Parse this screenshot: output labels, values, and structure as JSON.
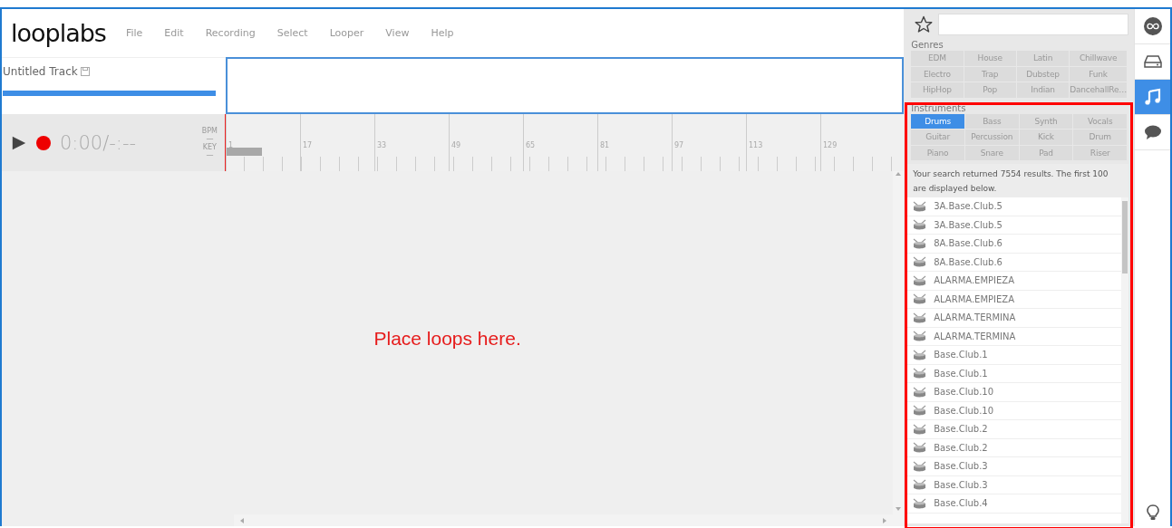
{
  "app": {
    "logo": "looplabs"
  },
  "menu": [
    {
      "label": "File"
    },
    {
      "label": "Edit"
    },
    {
      "label": "Recording"
    },
    {
      "label": "Select"
    },
    {
      "label": "Looper"
    },
    {
      "label": "View"
    },
    {
      "label": "Help"
    }
  ],
  "track": {
    "title": "Untitled Track",
    "level": 1
  },
  "transport": {
    "time": "0:00/-:--",
    "bpm_label": "BPM",
    "bpm_value": "—",
    "key_label": "KEY",
    "key_value": "—"
  },
  "ruler": [
    "1",
    "17",
    "33",
    "49",
    "65",
    "81",
    "97",
    "113",
    "129"
  ],
  "workspace": {
    "placeholder": "Place loops here."
  },
  "library": {
    "genres_label": "Genres",
    "genres": [
      {
        "label": "EDM",
        "selected": false
      },
      {
        "label": "House",
        "selected": false
      },
      {
        "label": "Latin",
        "selected": false
      },
      {
        "label": "Chillwave",
        "selected": false
      },
      {
        "label": "Electro",
        "selected": false
      },
      {
        "label": "Trap",
        "selected": false
      },
      {
        "label": "Dubstep",
        "selected": false
      },
      {
        "label": "Funk",
        "selected": false
      },
      {
        "label": "HipHop",
        "selected": false
      },
      {
        "label": "Pop",
        "selected": false
      },
      {
        "label": "Indian",
        "selected": false
      },
      {
        "label": "DancehallRe…",
        "selected": false
      }
    ],
    "instruments_label": "Instruments",
    "instruments": [
      {
        "label": "Drums",
        "selected": true
      },
      {
        "label": "Bass",
        "selected": false
      },
      {
        "label": "Synth",
        "selected": false
      },
      {
        "label": "Vocals",
        "selected": false
      },
      {
        "label": "Guitar",
        "selected": false
      },
      {
        "label": "Percussion",
        "selected": false
      },
      {
        "label": "Kick",
        "selected": false
      },
      {
        "label": "Drum",
        "selected": false
      },
      {
        "label": "Piano",
        "selected": false
      },
      {
        "label": "Snare",
        "selected": false
      },
      {
        "label": "Pad",
        "selected": false
      },
      {
        "label": "Riser",
        "selected": false
      }
    ],
    "results": "Your search returned 7554 results. The first 100 are displayed below.",
    "loops": [
      {
        "name": "3A.Base.Club.5"
      },
      {
        "name": "3A.Base.Club.5"
      },
      {
        "name": "8A.Base.Club.6"
      },
      {
        "name": "8A.Base.Club.6"
      },
      {
        "name": "ALARMA.EMPIEZA"
      },
      {
        "name": "ALARMA.EMPIEZA"
      },
      {
        "name": "ALARMA.TERMINA"
      },
      {
        "name": "ALARMA.TERMINA"
      },
      {
        "name": "Base.Club.1"
      },
      {
        "name": "Base.Club.1"
      },
      {
        "name": "Base.Club.10"
      },
      {
        "name": "Base.Club.10"
      },
      {
        "name": "Base.Club.2"
      },
      {
        "name": "Base.Club.2"
      },
      {
        "name": "Base.Club.3"
      },
      {
        "name": "Base.Club.3"
      },
      {
        "name": "Base.Club.4"
      }
    ]
  },
  "rail": [
    {
      "kind": "loop",
      "selected": false
    },
    {
      "kind": "drive",
      "selected": false
    },
    {
      "kind": "music",
      "selected": true
    },
    {
      "kind": "chat",
      "selected": false
    },
    {
      "kind": "tip",
      "selected": false
    }
  ]
}
